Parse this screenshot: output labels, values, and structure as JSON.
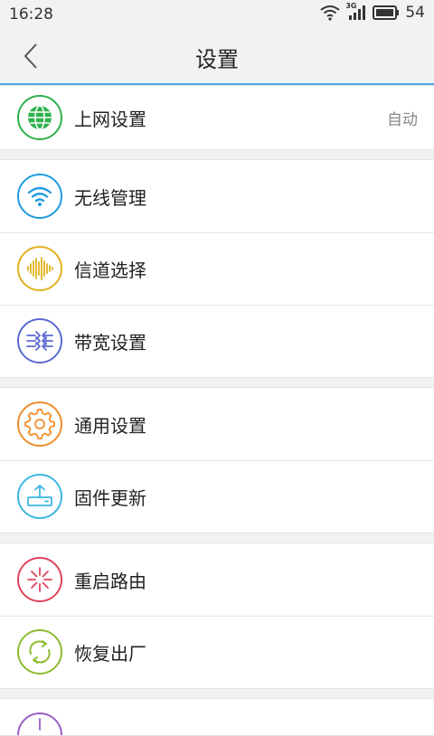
{
  "status_bar": {
    "time": "16:28",
    "network_label": "3G",
    "battery_level": "54",
    "icons": [
      "wifi-icon",
      "cellular-signal-icon",
      "battery-icon"
    ]
  },
  "header": {
    "title": "设置",
    "back_icon": "chevron-left-icon"
  },
  "colors": {
    "accent": "#49a5e6",
    "globe": "#2fb24c",
    "wifi": "#1e9be0",
    "channel": "#e0b21e",
    "bandwidth": "#5b6ad0",
    "general": "#ef8d2e",
    "firmware": "#3bb8e0",
    "reboot": "#e0455c",
    "restore": "#8cbc2f",
    "partial": "#9a5cc8"
  },
  "groups": [
    {
      "items": [
        {
          "label": "上网设置",
          "value": "自动",
          "icon": "globe-icon"
        }
      ]
    },
    {
      "items": [
        {
          "label": "无线管理",
          "icon": "wifi-icon"
        },
        {
          "label": "信道选择",
          "icon": "sound-wave-icon"
        },
        {
          "label": "带宽设置",
          "icon": "bandwidth-arrows-icon"
        }
      ]
    },
    {
      "items": [
        {
          "label": "通用设置",
          "icon": "gear-icon"
        },
        {
          "label": "固件更新",
          "icon": "upload-icon"
        }
      ]
    },
    {
      "items": [
        {
          "label": "重启路由",
          "icon": "reboot-icon"
        },
        {
          "label": "恢复出厂",
          "icon": "restore-icon"
        }
      ]
    }
  ]
}
